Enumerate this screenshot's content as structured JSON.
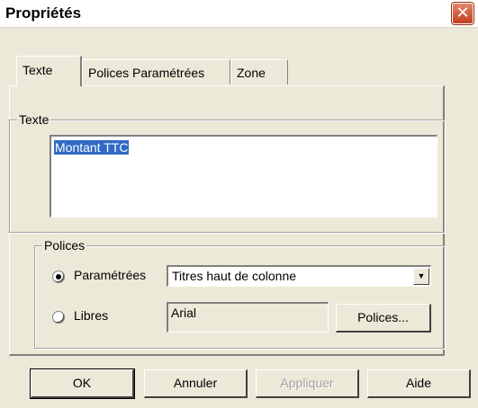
{
  "window": {
    "title": "Propriétés",
    "close_glyph": "✕"
  },
  "tabs": [
    {
      "label": "Texte",
      "active": true
    },
    {
      "label": "Polices Paramétrées",
      "active": false
    },
    {
      "label": "Zone",
      "active": false
    }
  ],
  "texte_group": {
    "legend": "Texte",
    "value": "Montant TTC"
  },
  "polices_group": {
    "legend": "Polices",
    "options": [
      {
        "label": "Paramétrées",
        "checked": true,
        "selected_value": "Titres haut de colonne",
        "arrow_glyph": "▼"
      },
      {
        "label": "Libres",
        "checked": false,
        "font_value": "Arial",
        "button_label": "Polices..."
      }
    ]
  },
  "buttons": {
    "ok": "OK",
    "cancel": "Annuler",
    "apply": "Appliquer",
    "help": "Aide"
  }
}
